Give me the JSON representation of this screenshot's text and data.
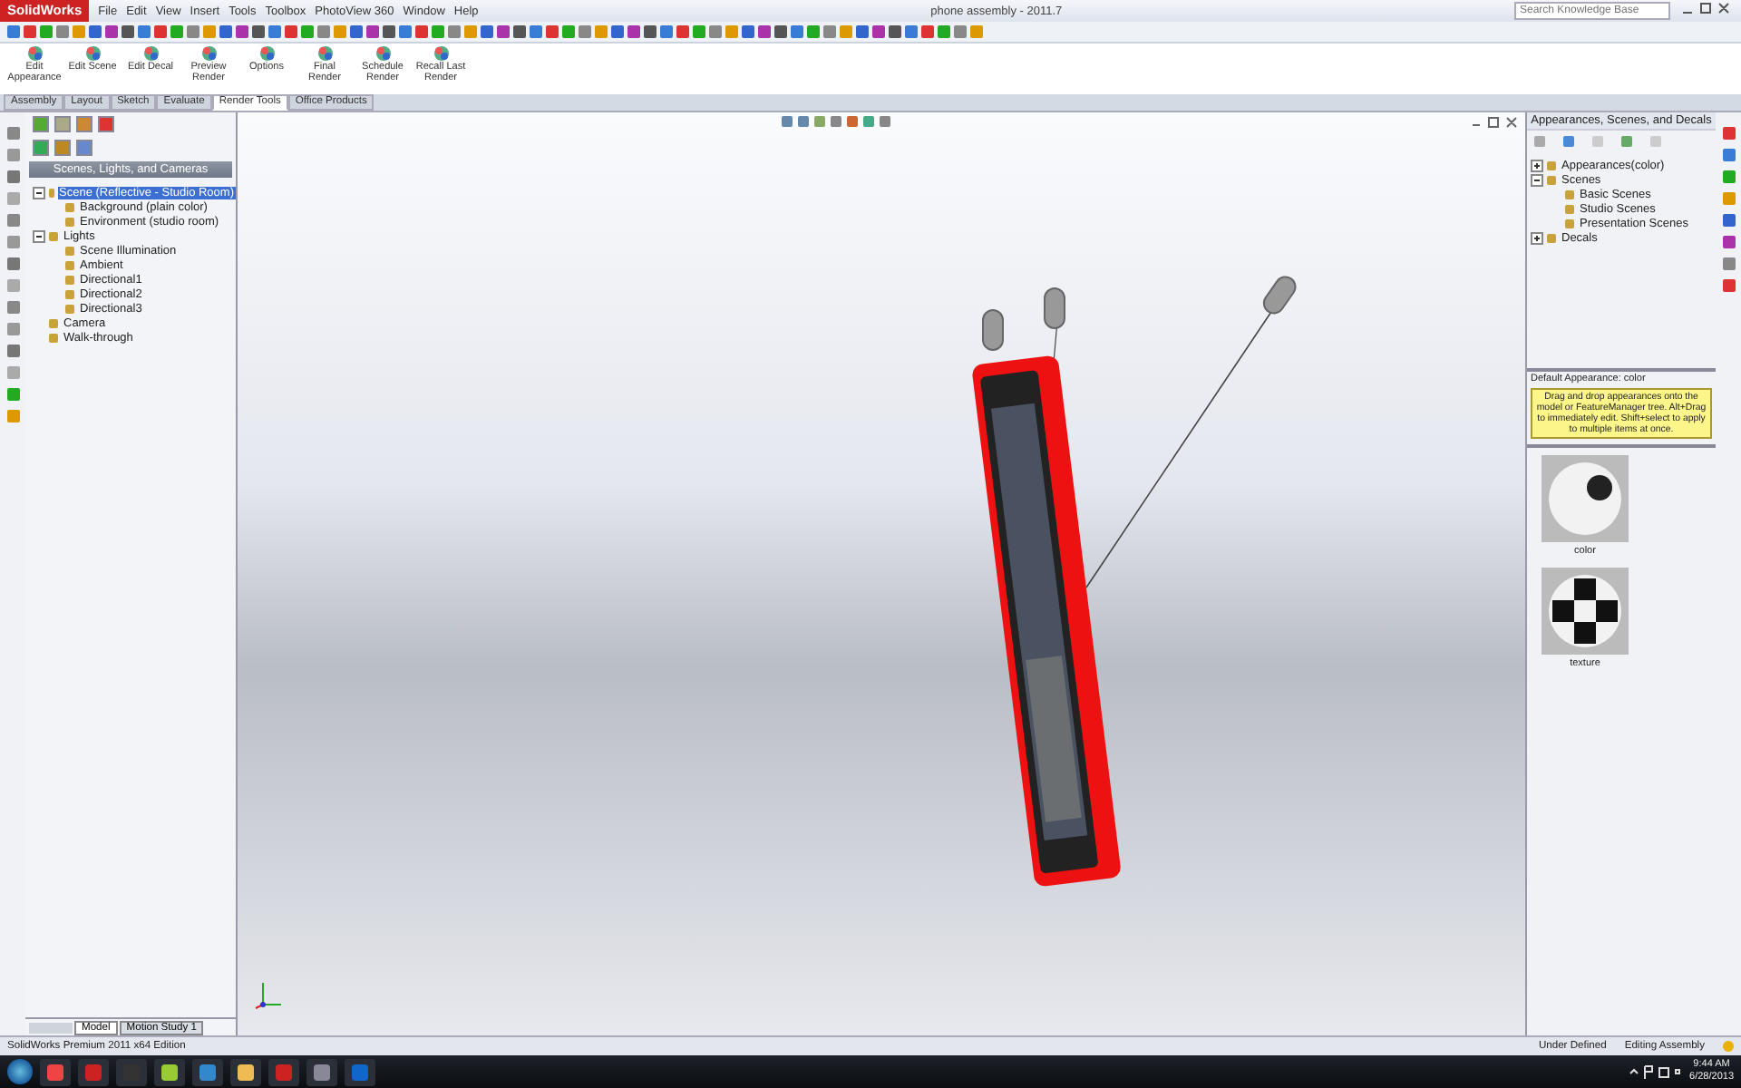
{
  "app": {
    "logo": "SolidWorks",
    "menus": [
      "File",
      "Edit",
      "View",
      "Insert",
      "Tools",
      "Toolbox",
      "PhotoView 360",
      "Window",
      "Help"
    ],
    "document_title": "phone assembly - 2011.7",
    "search": {
      "placeholder": "Search Knowledge Base"
    }
  },
  "command_manager": {
    "buttons": [
      {
        "label": "Edit Appearance"
      },
      {
        "label": "Edit Scene"
      },
      {
        "label": "Edit Decal"
      },
      {
        "label": "Preview Render"
      },
      {
        "label": "Options"
      },
      {
        "label": "Final Render"
      },
      {
        "label": "Schedule Render"
      },
      {
        "label": "Recall Last Render"
      }
    ],
    "tabs": [
      {
        "label": "Assembly",
        "selected": false
      },
      {
        "label": "Layout",
        "selected": false
      },
      {
        "label": "Sketch",
        "selected": false
      },
      {
        "label": "Evaluate",
        "selected": false
      },
      {
        "label": "Render Tools",
        "selected": true
      },
      {
        "label": "Office Products",
        "selected": false
      }
    ]
  },
  "left_panel": {
    "title": "Scenes, Lights, and Cameras",
    "tree": [
      {
        "label": "Scene (Reflective - Studio Room)",
        "selected": true,
        "expanded": true,
        "children": [
          {
            "label": "Background (plain color)",
            "selected": false
          },
          {
            "label": "Environment (studio room)",
            "selected": false
          }
        ]
      },
      {
        "label": "Lights",
        "selected": false,
        "expanded": true,
        "children": [
          {
            "label": "Scene Illumination",
            "selected": false
          },
          {
            "label": "Ambient",
            "selected": false
          },
          {
            "label": "Directional1",
            "selected": false
          },
          {
            "label": "Directional2",
            "selected": false
          },
          {
            "label": "Directional3",
            "selected": false
          }
        ]
      },
      {
        "label": "Camera",
        "selected": false
      },
      {
        "label": "Walk-through",
        "selected": false
      }
    ]
  },
  "right_panel": {
    "title": "Appearances, Scenes, and Decals",
    "tree": [
      {
        "label": "Appearances(color)",
        "expanded": false
      },
      {
        "label": "Scenes",
        "expanded": true,
        "children": [
          {
            "label": "Basic Scenes"
          },
          {
            "label": "Studio Scenes"
          },
          {
            "label": "Presentation Scenes"
          }
        ]
      },
      {
        "label": "Decals",
        "expanded": false
      }
    ],
    "section_label": "Default Appearance: color",
    "tooltip": "Drag and drop appearances onto the model or FeatureManager tree. Alt+Drag to immediately edit. Shift+select to apply to multiple items at once.",
    "thumbnails": [
      {
        "label": "color",
        "kind": "plain"
      },
      {
        "label": "texture",
        "kind": "checker"
      }
    ]
  },
  "bottom_tabs": [
    {
      "label": "Model",
      "selected": true
    },
    {
      "label": "Motion Study 1",
      "selected": false
    }
  ],
  "status_bar": {
    "edition": "SolidWorks Premium 2011 x64 Edition",
    "state": "Under Defined",
    "mode": "Editing Assembly"
  },
  "taskbar": {
    "time": "9:44 AM",
    "date": "6/28/2013"
  }
}
